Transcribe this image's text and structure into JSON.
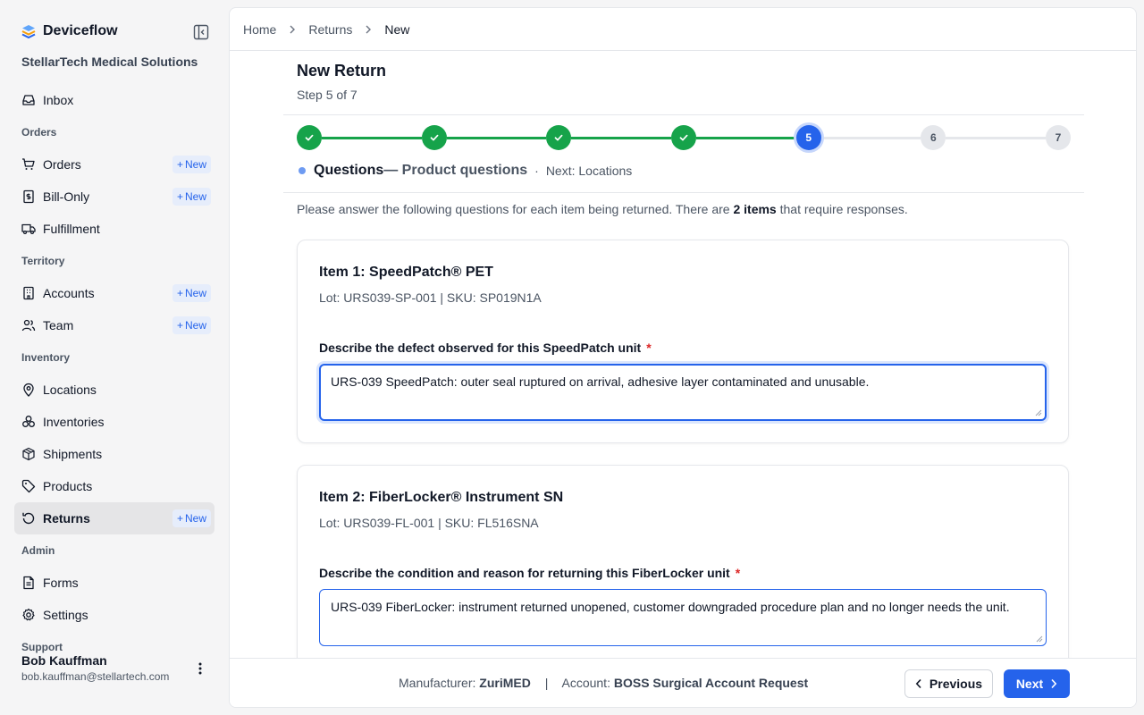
{
  "app": {
    "name": "Deviceflow",
    "org": "StellarTech Medical Solutions"
  },
  "sidebar": {
    "new_label": "New",
    "inbox": "Inbox",
    "sections": {
      "orders": "Orders",
      "territory": "Territory",
      "inventory": "Inventory",
      "admin": "Admin",
      "support": "Support"
    },
    "items": {
      "orders": "Orders",
      "bill_only": "Bill-Only",
      "fulfillment": "Fulfillment",
      "accounts": "Accounts",
      "team": "Team",
      "locations": "Locations",
      "inventories": "Inventories",
      "shipments": "Shipments",
      "products": "Products",
      "returns": "Returns",
      "forms": "Forms",
      "settings": "Settings"
    },
    "user": {
      "name": "Bob Kauffman",
      "email": "bob.kauffman@stellartech.com"
    }
  },
  "breadcrumb": [
    "Home",
    "Returns",
    "New"
  ],
  "page": {
    "title": "New Return",
    "subtitle": "Step 5 of 7"
  },
  "stepper": {
    "total": 7,
    "current": 5,
    "steps": [
      "1",
      "2",
      "3",
      "4",
      "5",
      "6",
      "7"
    ],
    "current_name": "Questions",
    "current_desc": "— Product questions",
    "next": "Next: Locations",
    "bullet": "·"
  },
  "intro": {
    "before": "Please answer the following questions for each item being returned. There are ",
    "count": "2 items",
    "after": " that require responses."
  },
  "items": [
    {
      "title": "Item 1: SpeedPatch® PET",
      "meta": "Lot: URS039-SP-001 | SKU: SP019N1A",
      "question": "Describe the defect observed for this SpeedPatch unit",
      "required": "*",
      "answer": "URS-039 SpeedPatch: outer seal ruptured on arrival, adhesive layer contaminated and unusable."
    },
    {
      "title": "Item 2: FiberLocker® Instrument SN",
      "meta": "Lot: URS039-FL-001 | SKU: FL516SNA",
      "question": "Describe the condition and reason for returning this FiberLocker unit",
      "required": "*",
      "answer": "URS-039 FiberLocker: instrument returned unopened, customer downgraded procedure plan and no longer needs the unit."
    }
  ],
  "footer": {
    "manufacturer_label": "Manufacturer:",
    "manufacturer": "ZuriMED",
    "pipe": "|",
    "account_label": "Account:",
    "account": "BOSS Surgical Account Request",
    "previous": "Previous",
    "next": "Next"
  },
  "colors": {
    "accent": "#2563eb",
    "success": "#16a34a",
    "required": "#dc2626"
  }
}
